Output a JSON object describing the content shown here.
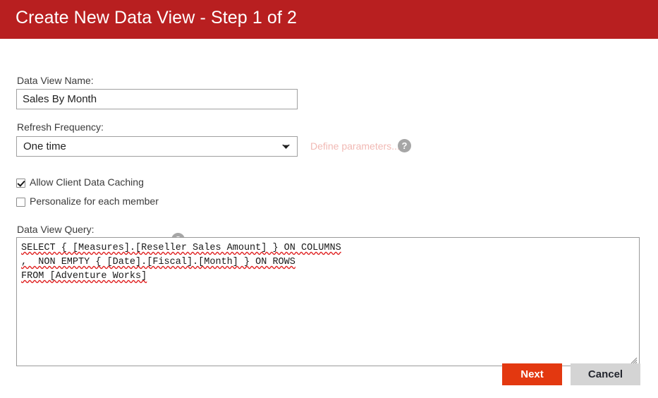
{
  "header": {
    "title": "Create New Data View - Step 1 of 2",
    "bar_color": "#b81f20"
  },
  "form": {
    "data_view_name": {
      "label": "Data View Name:",
      "value": "Sales By Month",
      "placeholder": ""
    },
    "refresh_frequency": {
      "label": "Refresh Frequency:",
      "selected": "One time",
      "options": [
        "One time"
      ],
      "chevron_icon": "chevron-down-icon"
    },
    "define_parameters": {
      "label": "Define parameters...",
      "color": "#f1b9b4",
      "disabled": true,
      "help_icon": "help-icon"
    },
    "allow_client_data_caching": {
      "label": "Allow Client Data Caching",
      "checked": true
    },
    "personalize_for_each_member": {
      "label": "Personalize for each member",
      "checked": false,
      "help_icon": "help-icon"
    },
    "data_view_query": {
      "label": "Data View Query:",
      "value": "SELECT { [Measures].[Reseller Sales Amount] } ON COLUMNS\n,  NON EMPTY { [Date].[Fiscal].[Month] } ON ROWS\nFROM [Adventure Works]",
      "spellcheck_underline_color": "#e02020",
      "resize_handle_icon": "resize-grip-icon"
    }
  },
  "footer": {
    "next_label": "Next",
    "next_color": "#e33810",
    "cancel_label": "Cancel",
    "cancel_color": "#d4d4d4"
  },
  "help_glyph": "?"
}
